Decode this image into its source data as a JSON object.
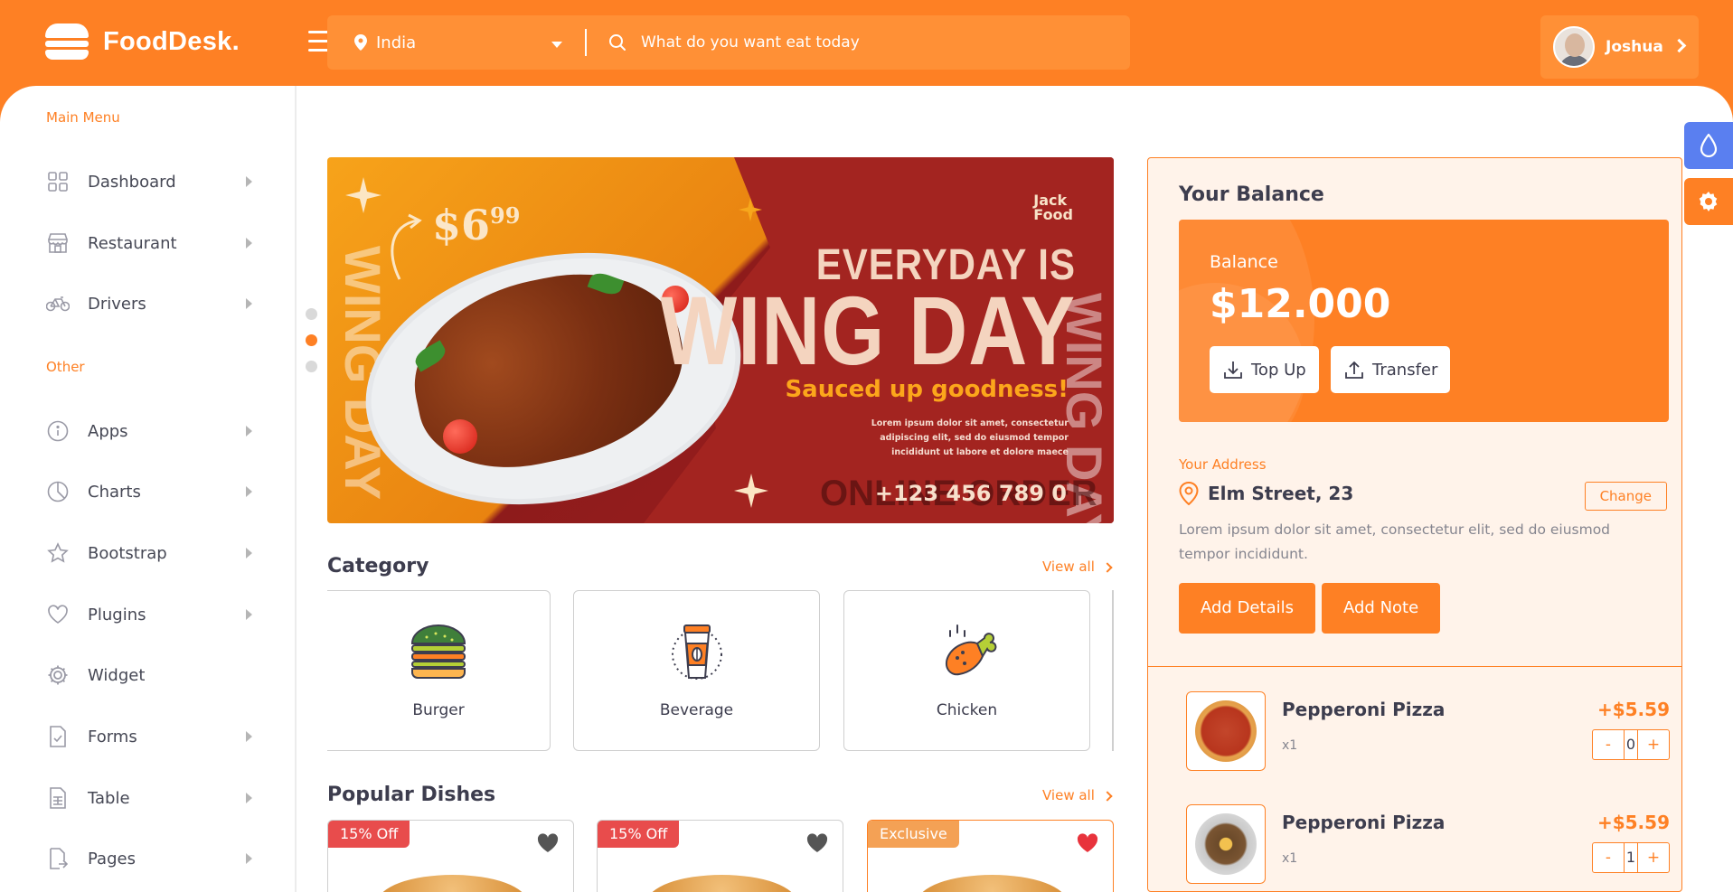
{
  "header": {
    "logo_text": "FoodDesk.",
    "location": "India",
    "search_placeholder": "What do you want eat today",
    "user_name": "Joshua"
  },
  "sidebar": {
    "main_label": "Main Menu",
    "main_items": [
      {
        "label": "Dashboard",
        "icon": "grid-icon"
      },
      {
        "label": "Restaurant",
        "icon": "store-icon"
      },
      {
        "label": "Drivers",
        "icon": "bicycle-icon"
      }
    ],
    "other_label": "Other",
    "other_items": [
      {
        "label": "Apps",
        "icon": "info-icon"
      },
      {
        "label": "Charts",
        "icon": "pie-chart-icon"
      },
      {
        "label": "Bootstrap",
        "icon": "star-icon"
      },
      {
        "label": "Plugins",
        "icon": "heart-icon"
      },
      {
        "label": "Widget",
        "icon": "gear-icon"
      },
      {
        "label": "Forms",
        "icon": "form-icon"
      },
      {
        "label": "Table",
        "icon": "table-icon"
      },
      {
        "label": "Pages",
        "icon": "page-icon"
      }
    ]
  },
  "banner": {
    "price": "$6",
    "price_cents": "99",
    "brand_line1": "Jack",
    "brand_line2": "Food",
    "headline_top": "EVERYDAY IS",
    "headline_main": "WING DAY",
    "tagline": "Sauced up goodness!",
    "small_text": "Lorem ipsum dolor sit amet, consectetur adipiscing elit, sed do eiusmod tempor incididunt ut labore et dolore maece",
    "phone": "+123 456 789 0",
    "ghost_text": "ONLINE ORDER",
    "vertical_text": "WING DAY"
  },
  "category": {
    "title": "Category",
    "view_all": "View all",
    "items": [
      {
        "label": "Burger",
        "icon": "burger-icon"
      },
      {
        "label": "Beverage",
        "icon": "coffee-cup-icon"
      },
      {
        "label": "Chicken",
        "icon": "chicken-leg-icon"
      }
    ]
  },
  "popular": {
    "title": "Popular Dishes",
    "view_all": "View all",
    "items": [
      {
        "badge": "15% Off",
        "badge_color": "#e84c4c",
        "favorited": false
      },
      {
        "badge": "15% Off",
        "badge_color": "#e84c4c",
        "favorited": false
      },
      {
        "badge": "Exclusive",
        "badge_color": "#f4a155",
        "favorited": true
      }
    ]
  },
  "balance": {
    "title": "Your Balance",
    "label": "Balance",
    "amount": "$12.000",
    "top_up": "Top Up",
    "transfer": "Transfer"
  },
  "address": {
    "label": "Your Address",
    "street": "Elm Street, 23",
    "change": "Change",
    "description": "Lorem ipsum dolor sit amet, consectetur elit, sed do eiusmod tempor incididunt.",
    "add_details": "Add Details",
    "add_note": "Add Note"
  },
  "orders": [
    {
      "name": "Pepperoni Pizza",
      "qty": "x1",
      "price": "+$5.59",
      "count": "0",
      "minus": "-",
      "plus": "+"
    },
    {
      "name": "Pepperoni Pizza",
      "qty": "x1",
      "price": "+$5.59",
      "count": "1",
      "minus": "-",
      "plus": "+"
    }
  ],
  "colors": {
    "accent": "#fe8024",
    "panel_bg": "#fff3ea",
    "side_blue": "#5a7ff0"
  }
}
